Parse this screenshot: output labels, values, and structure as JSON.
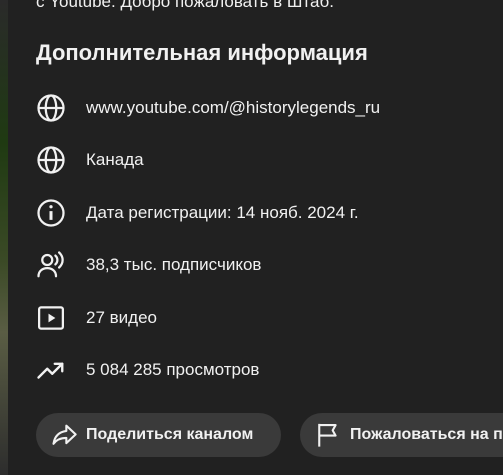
{
  "prev_text": "с Youtube. Добро пожаловать в Штаб.",
  "section_title": "Дополнительная информация",
  "rows": [
    {
      "icon": "globe-icon",
      "label": "www.youtube.com/@historylegends_ru"
    },
    {
      "icon": "globe-icon",
      "label": "Канада"
    },
    {
      "icon": "info-icon",
      "label": "Дата регистрации: 14 нояб. 2024 г."
    },
    {
      "icon": "subscribers-icon",
      "label": "38,3 тыс. подписчиков"
    },
    {
      "icon": "video-icon",
      "label": "27 видео"
    },
    {
      "icon": "trending-icon",
      "label": "5 084 285 просмотров"
    }
  ],
  "buttons": {
    "share_label": "Поделиться каналом",
    "report_label": "Пожаловаться на п"
  }
}
